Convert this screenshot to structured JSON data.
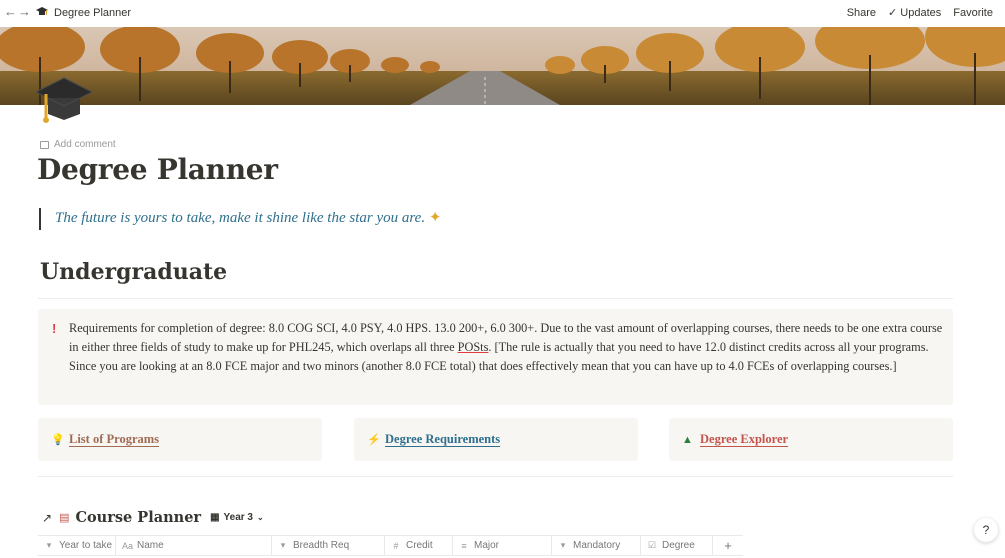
{
  "topbar": {
    "back_icon": "arrow-left-icon",
    "forward_icon": "arrow-right-icon",
    "breadcrumb": "Degree Planner",
    "share": "Share",
    "updates": "Updates",
    "favorite": "Favorite"
  },
  "page": {
    "add_comment": "Add comment",
    "title": "Degree Planner",
    "quote": "The future is yours to take, make it shine like the star you are.",
    "quote_emoji": "✦",
    "heading": "Undergraduate"
  },
  "callout": {
    "icon": "!",
    "text_before": "Requirements for completion of degree: 8.0 COG SCI, 4.0 PSY, 4.0 HPS. 13.0 200+, 6.0 300+.  Due to the vast amount of overlapping courses, there needs to be one extra course in either three fields of study to make up for PHL245, which overlaps all three ",
    "text_link": "POSts",
    "text_after": ". [The rule is actually that you need to have 12.0 distinct credits across all your programs. Since you are looking at an 8.0 FCE major and two minors (another 8.0 FCE total) that does effectively mean that you can have up to 4.0 FCEs of overlapping courses.]"
  },
  "links": [
    {
      "label": "List of Programs",
      "icon": "lightbulb-icon",
      "color": "#9f6b53"
    },
    {
      "label": "Degree Requirements",
      "icon": "lightning-icon",
      "color": "#2e6f8c"
    },
    {
      "label": "Degree Explorer",
      "icon": "tree-icon",
      "color": "#c4554d"
    }
  ],
  "database": {
    "title": "Course Planner",
    "view": "Year 3",
    "columns": [
      {
        "label": "Year to take",
        "icon": "select-icon"
      },
      {
        "label": "Name",
        "icon": "text-icon"
      },
      {
        "label": "Breadth Req",
        "icon": "select-icon"
      },
      {
        "label": "Credit",
        "icon": "number-icon"
      },
      {
        "label": "Major",
        "icon": "list-icon"
      },
      {
        "label": "Mandatory",
        "icon": "select-icon"
      },
      {
        "label": "Degree",
        "icon": "checkbox-icon"
      }
    ],
    "add_column": "+"
  },
  "help": "?"
}
